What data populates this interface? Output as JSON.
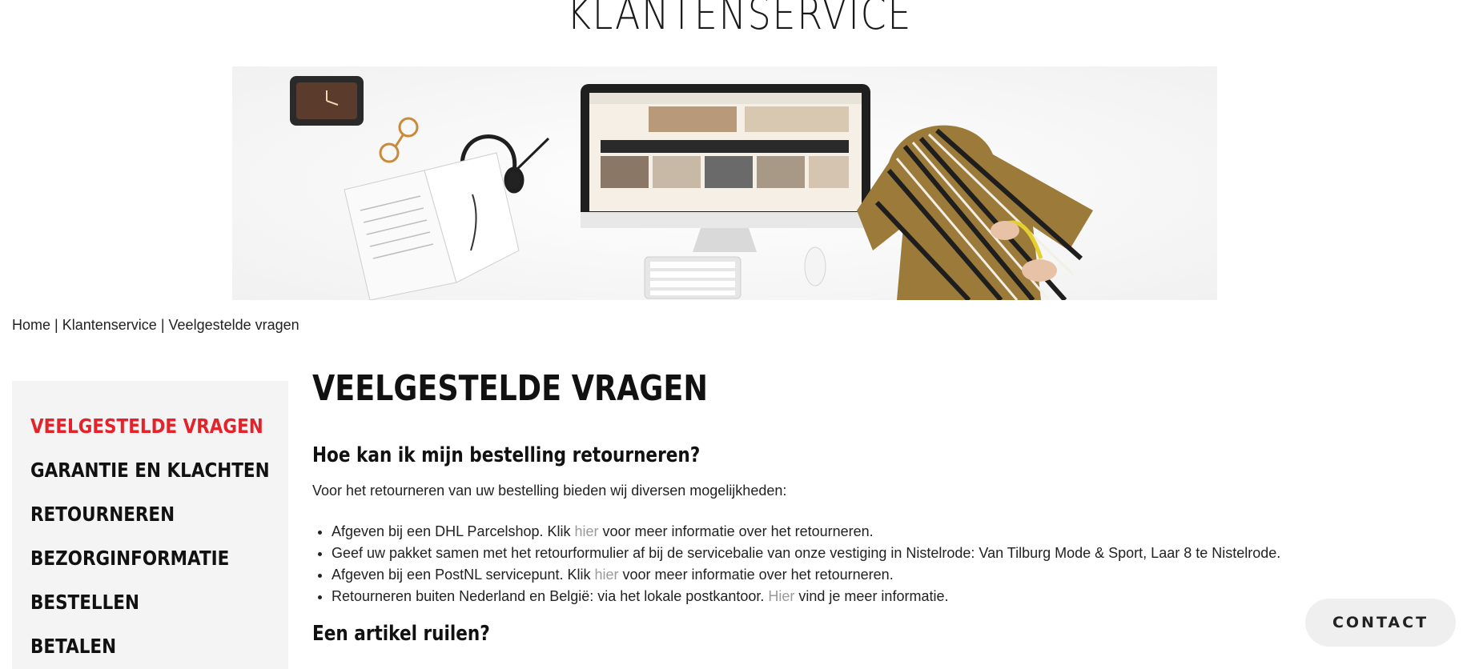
{
  "header": {
    "title": "KLANTENSERVICE"
  },
  "hero": {
    "image": "customer-service-flatlay"
  },
  "breadcrumb": {
    "items": [
      "Home",
      "Klantenservice",
      "Veelgestelde vragen"
    ],
    "separator": "|"
  },
  "sidebar": {
    "items": [
      {
        "label": "VEELGESTELDE VRAGEN",
        "active": true
      },
      {
        "label": "GARANTIE EN KLACHTEN"
      },
      {
        "label": "RETOURNEREN"
      },
      {
        "label": "BEZORGINFORMATIE"
      },
      {
        "label": "BESTELLEN"
      },
      {
        "label": "BETALEN"
      }
    ]
  },
  "content": {
    "title": "VEELGESTELDE VRAGEN",
    "q1": {
      "heading": "Hoe kan ik mijn bestelling retourneren?",
      "intro": "Voor het retourneren van uw bestelling bieden wij diversen mogelijkheden:",
      "options": [
        {
          "before": "Afgeven bij een DHL Parcelshop. Klik ",
          "link": "hier",
          "after": " voor meer informatie over het retourneren."
        },
        {
          "before": "Geef uw pakket samen met het retourformulier af bij de servicebalie van onze vestiging in Nistelrode: Van Tilburg Mode & Sport, Laar 8 te Nistelrode.",
          "link": "",
          "after": ""
        },
        {
          "before": "Afgeven bij een PostNL servicepunt. Klik ",
          "link": "hier",
          "after": " voor meer informatie over het retourneren."
        },
        {
          "before": "Retourneren buiten Nederland en België: via het lokale postkantoor. ",
          "link": "Hier",
          "after": " vind je meer informatie."
        }
      ]
    },
    "q2": {
      "heading": "Een artikel ruilen?"
    }
  },
  "contact": {
    "label": "CONTACT"
  },
  "colors": {
    "accent": "#e3222a",
    "link": "#9a9a9a",
    "sidebar_bg": "#f4f4f4"
  }
}
